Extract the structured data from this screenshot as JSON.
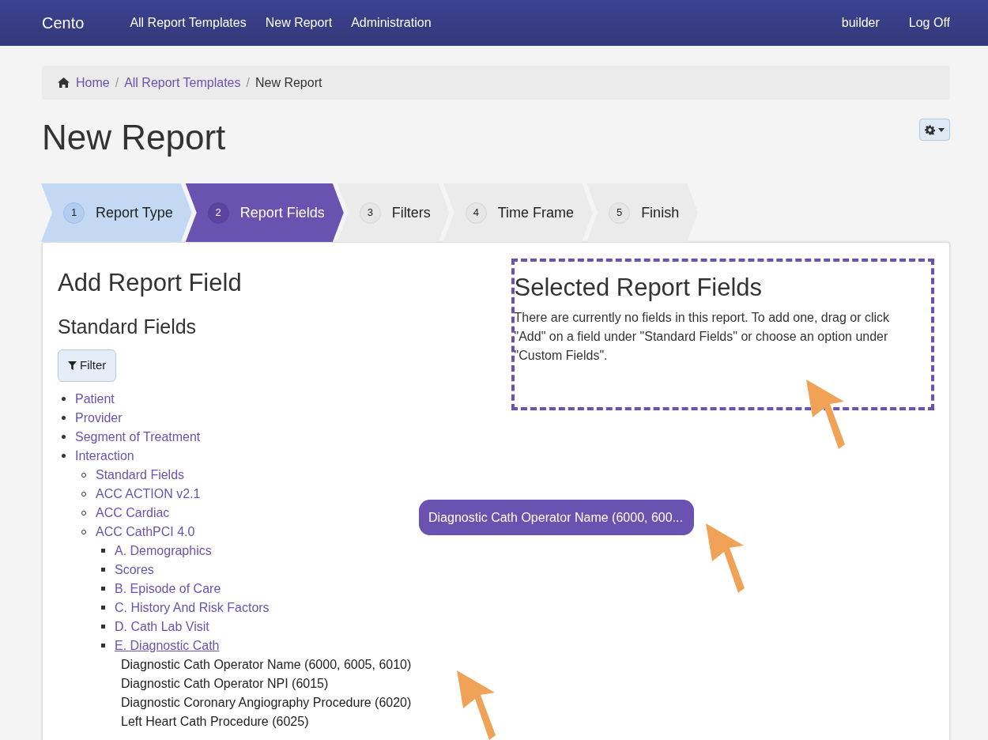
{
  "navbar": {
    "brand": "Cento",
    "links": [
      "All Report Templates",
      "New Report",
      "Administration"
    ],
    "right_links": [
      "builder",
      "Log Off"
    ]
  },
  "breadcrumb": [
    {
      "label": "Home",
      "kind": "home",
      "current": false
    },
    {
      "separator": "/",
      "label": "All Report Templates",
      "kind": "link",
      "current": false
    },
    {
      "separator": "/",
      "label": "New Report",
      "kind": "link",
      "current": true
    }
  ],
  "page_title": "New Report",
  "wizard_steps": [
    {
      "number": "1",
      "label": "Report Type",
      "completed": true,
      "selected": false
    },
    {
      "number": "2",
      "label": "Report Fields",
      "completed": false,
      "selected": true
    },
    {
      "number": "3",
      "label": "Filters",
      "completed": false,
      "selected": false
    },
    {
      "number": "4",
      "label": "Time Frame",
      "completed": false,
      "selected": false
    },
    {
      "number": "5",
      "label": "Finish",
      "completed": false,
      "selected": false
    }
  ],
  "add_panel": {
    "title": "Add Report Field",
    "subtitle": "Standard Fields",
    "filter_button": "Filter",
    "tree": [
      {
        "label": "Patient",
        "kind": "link",
        "hovered": false
      },
      {
        "label": "Provider",
        "kind": "link",
        "hovered": false
      },
      {
        "label": "Segment of Treatment",
        "kind": "link",
        "hovered": false
      },
      {
        "label": "Interaction",
        "kind": "link",
        "hovered": false,
        "children": [
          {
            "label": "Standard Fields",
            "kind": "link",
            "hovered": false
          },
          {
            "label": "ACC ACTION v2.1",
            "kind": "link",
            "hovered": false
          },
          {
            "label": "ACC Cardiac",
            "kind": "link",
            "hovered": false
          },
          {
            "label": "ACC CathPCI 4.0",
            "kind": "link",
            "hovered": false,
            "children": [
              {
                "label": "A. Demographics",
                "kind": "link",
                "hovered": false
              },
              {
                "label": "Scores",
                "kind": "link",
                "hovered": false
              },
              {
                "label": "B. Episode of Care",
                "kind": "link",
                "hovered": false
              },
              {
                "label": "C. History And Risk Factors",
                "kind": "link",
                "hovered": false
              },
              {
                "label": "D. Cath Lab Visit",
                "kind": "link",
                "hovered": false
              },
              {
                "label": "E. Diagnostic Cath",
                "kind": "link",
                "hovered": true,
                "children": [
                  {
                    "label": "Diagnostic Cath Operator Name (6000, 6005, 6010)",
                    "kind": "field"
                  },
                  {
                    "label": "Diagnostic Cath Operator NPI (6015)",
                    "kind": "field"
                  },
                  {
                    "label": "Diagnostic Coronary Angiography Procedure (6020)",
                    "kind": "field"
                  },
                  {
                    "label": "Left Heart Cath Procedure (6025)",
                    "kind": "field"
                  }
                ]
              }
            ]
          }
        ]
      }
    ]
  },
  "selected_panel": {
    "title": "Selected Report Fields",
    "message": "There are currently no fields in this report. To add one, drag or click \"Add\" on a field under \"Standard Fields\" or choose an option under \"Custom Fields\"."
  },
  "drag_chip": "Diagnostic Cath Operator Name (6000, 600..."
}
